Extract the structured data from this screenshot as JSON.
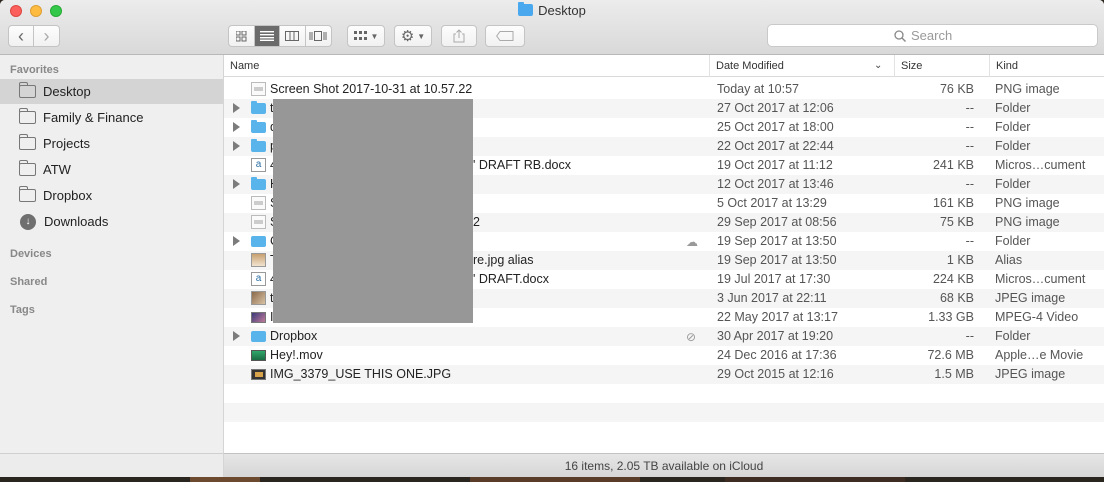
{
  "window": {
    "title": "Desktop"
  },
  "toolbar": {
    "back_label": "‹",
    "forward_label": "›",
    "share_icon": "share-icon",
    "tag_icon": "tag-icon"
  },
  "search": {
    "placeholder": "Search"
  },
  "sidebar": {
    "sections": {
      "favorites": "Favorites",
      "devices": "Devices",
      "shared": "Shared",
      "tags": "Tags"
    },
    "items": [
      {
        "label": "Desktop",
        "selected": true
      },
      {
        "label": "Family & Finance"
      },
      {
        "label": "Projects"
      },
      {
        "label": "ATW"
      },
      {
        "label": "Dropbox"
      },
      {
        "label": "Downloads"
      }
    ]
  },
  "columns": {
    "name": "Name",
    "date": "Date Modified",
    "size": "Size",
    "kind": "Kind"
  },
  "files": [
    {
      "name": "Screen Shot 2017-10-31 at 10.57.22",
      "date": "Today at 10:57",
      "size": "76 KB",
      "kind": "PNG image",
      "icon": "png"
    },
    {
      "name": "te",
      "date": "27 Oct 2017 at 12:06",
      "size": "--",
      "kind": "Folder",
      "icon": "folder"
    },
    {
      "name": "d",
      "date": "25 Oct 2017 at 18:00",
      "size": "--",
      "kind": "Folder",
      "icon": "folder"
    },
    {
      "name": "p",
      "date": "22 Oct 2017 at 22:44",
      "size": "--",
      "kind": "Folder",
      "icon": "folder"
    },
    {
      "name": "4",
      "name_tail": "' DRAFT RB.docx",
      "date": "19 Oct 2017 at 11:12",
      "size": "241 KB",
      "kind": "Micros…cument",
      "icon": "doc"
    },
    {
      "name": "H",
      "date": "12 Oct 2017 at 13:46",
      "size": "--",
      "kind": "Folder",
      "icon": "folder"
    },
    {
      "name": "S",
      "date": "5 Oct 2017 at 13:29",
      "size": "161 KB",
      "kind": "PNG image",
      "icon": "png"
    },
    {
      "name": "S",
      "name_tail": "2",
      "date": "29 Sep 2017 at 08:56",
      "size": "75 KB",
      "kind": "PNG image",
      "icon": "png"
    },
    {
      "name": "C",
      "date": "19 Sep 2017 at 13:50",
      "size": "--",
      "kind": "Folder",
      "icon": "shared"
    },
    {
      "name": "T",
      "name_tail": "re.jpg alias",
      "date": "19 Sep 2017 at 13:50",
      "size": "1 KB",
      "kind": "Alias",
      "icon": "alias"
    },
    {
      "name": "4",
      "name_tail": "' DRAFT.docx",
      "date": "19 Jul 2017 at 17:30",
      "size": "224 KB",
      "kind": "Micros…cument",
      "icon": "doc"
    },
    {
      "name": "te",
      "date": "3 Jun 2017 at 22:11",
      "size": "68 KB",
      "kind": "JPEG image",
      "icon": "jpg"
    },
    {
      "name": "IS",
      "date": "22 May 2017 at 13:17",
      "size": "1.33 GB",
      "kind": "MPEG-4 Video",
      "icon": "video"
    },
    {
      "name": "Dropbox",
      "date": "30 Apr 2017 at 19:20",
      "size": "--",
      "kind": "Folder",
      "icon": "shared"
    },
    {
      "name": "Hey!.mov",
      "date": "24 Dec 2016 at 17:36",
      "size": "72.6 MB",
      "kind": "Apple…e Movie",
      "icon": "mov"
    },
    {
      "name": "IMG_3379_USE THIS ONE.JPG",
      "date": "29 Oct 2015 at 12:16",
      "size": "1.5 MB",
      "kind": "JPEG image",
      "icon": "img"
    }
  ],
  "status": {
    "text": "16 items, 2.05 TB available on iCloud"
  },
  "colors": {
    "folder": "#5ab4ec",
    "selection": "#d4d4d4",
    "sidebar": "#f0eff0"
  }
}
